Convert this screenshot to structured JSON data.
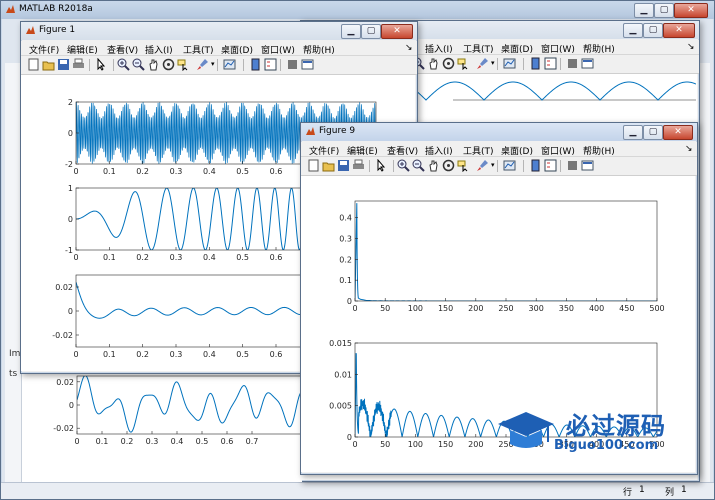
{
  "matlab": {
    "title": "MATLAB R2018a",
    "status_row_label": "行",
    "status_row_value": "1",
    "status_col_label": "列",
    "status_col_value": "1",
    "cmd_prefix": "Im",
    "ws_prefix": "ts"
  },
  "menu": [
    "文件(F)",
    "编辑(E)",
    "查看(V)",
    "插入(I)",
    "工具(T)",
    "桌面(D)",
    "窗口(W)",
    "帮助(H)"
  ],
  "bg_menu_tail": [
    "插入(I)",
    "工具(T)",
    "桌面(D)",
    "窗口(W)",
    "帮助(H)"
  ],
  "figure1": {
    "title": "Figure 1"
  },
  "figure9": {
    "title": "Figure 9"
  },
  "watermark": {
    "cn": "必过源码",
    "en": "Biguo100.com"
  },
  "icons": {
    "toolbar": [
      "new-file-icon",
      "open-folder-icon",
      "save-icon",
      "print-icon",
      "pointer-icon",
      "zoom-in-icon",
      "zoom-out-icon",
      "pan-icon",
      "rotate-icon",
      "data-cursor-icon",
      "brush-icon",
      "link-plot-icon",
      "colorbar-icon",
      "legend-icon",
      "hide-plot-tools-icon",
      "show-plot-tools-icon"
    ]
  },
  "chart_data": [
    {
      "type": "line",
      "id": "fig1-ax1",
      "xlim": [
        0,
        0.9
      ],
      "ylim": [
        -2,
        2
      ],
      "xticks": [
        "0",
        "0.1",
        "0.2",
        "0.3",
        "0.4",
        "0.5",
        "0.6",
        "0.7"
      ],
      "yticks": [
        "2",
        "0",
        "-2"
      ],
      "description_values": {
        "carrier_freq": 200,
        "envelope": "1.5 + 0.5*cos(2*pi*20*t)"
      }
    },
    {
      "type": "line",
      "id": "fig1-ax2",
      "xlim": [
        0,
        0.9
      ],
      "ylim": [
        -1,
        1
      ],
      "xticks": [
        "0",
        "0.1",
        "0.2",
        "0.3",
        "0.4",
        "0.5",
        "0.6",
        "0.7"
      ],
      "yticks": [
        "1",
        "0",
        "-1"
      ]
    },
    {
      "type": "line",
      "id": "fig1-ax3",
      "xlim": [
        0,
        0.9
      ],
      "ylim": [
        -0.03,
        0.03
      ],
      "xticks": [
        "0",
        "0.1",
        "0.2",
        "0.3",
        "0.4",
        "0.5",
        "0.6",
        "0.7"
      ],
      "yticks": [
        "0.02",
        "0",
        "-0.02"
      ]
    },
    {
      "type": "line",
      "id": "bg-ax4",
      "xlim": [
        0,
        0.9
      ],
      "ylim": [
        -0.025,
        0.025
      ],
      "xticks": [
        "0",
        "0.1",
        "0.2",
        "0.3",
        "0.4",
        "0.5",
        "0.6",
        "0.7"
      ],
      "yticks": [
        "0.02",
        "0",
        "-0.02"
      ]
    },
    {
      "type": "line",
      "id": "fig9-ax1",
      "xlim": [
        0,
        500
      ],
      "ylim": [
        0,
        0.48
      ],
      "xticks": [
        "0",
        "50",
        "100",
        "150",
        "200",
        "250",
        "300",
        "350",
        "400",
        "450",
        "500"
      ],
      "yticks": [
        "0.4",
        "0.3",
        "0.2",
        "0.1",
        "0"
      ]
    },
    {
      "type": "line",
      "id": "fig9-ax2",
      "xlim": [
        0,
        500
      ],
      "ylim": [
        0,
        0.015
      ],
      "xticks": [
        "0",
        "50",
        "100",
        "150",
        "200",
        "250",
        "300",
        "350",
        "400",
        "450",
        "500"
      ],
      "yticks": [
        "0.015",
        "0.01",
        "0.005",
        "0"
      ]
    }
  ]
}
